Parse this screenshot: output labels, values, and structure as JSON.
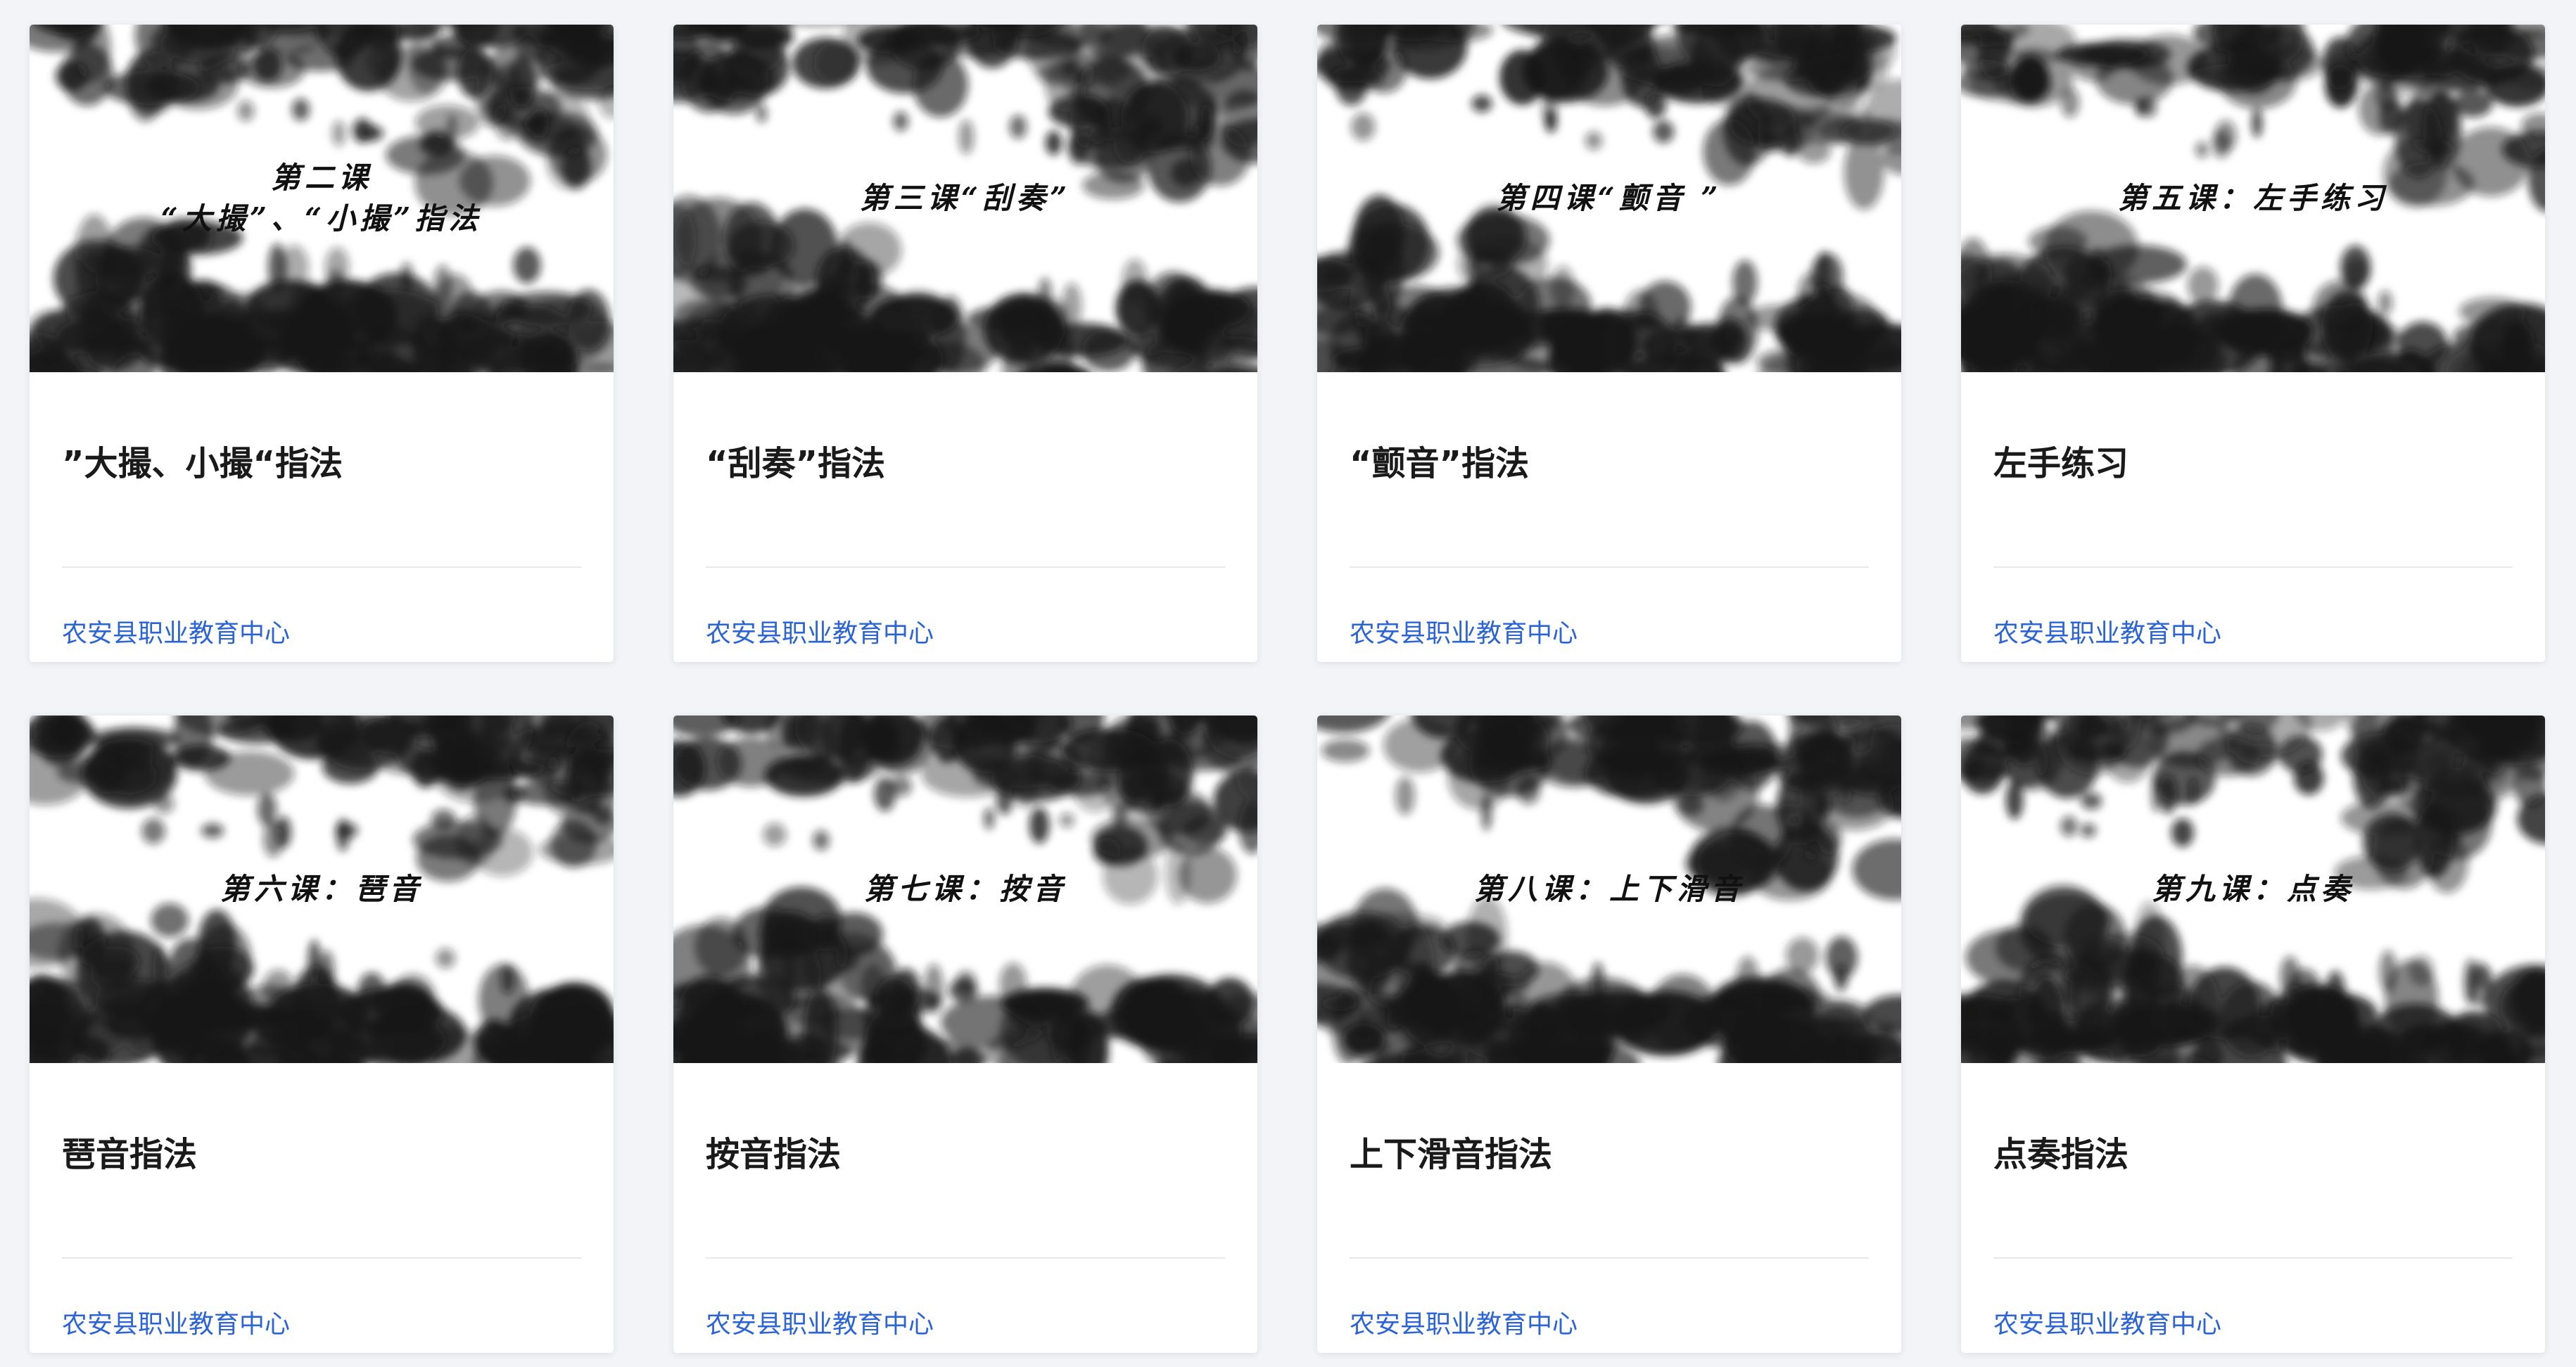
{
  "colors": {
    "page_background": "#f2f4f7",
    "card_background": "#ffffff",
    "title_text": "#1a1a1a",
    "org_link": "#2b64d6",
    "ink": "#111111"
  },
  "courses": [
    {
      "thumbnail_caption": "第二课\n“大撮”、“小撮”指法",
      "title": "”大撮、小撮“指法",
      "org": "农安县职业教育中心"
    },
    {
      "thumbnail_caption": "第三课“刮奏”",
      "title": "“刮奏”指法",
      "org": "农安县职业教育中心"
    },
    {
      "thumbnail_caption": "第四课“颤音 ”",
      "title": "“颤音”指法",
      "org": "农安县职业教育中心"
    },
    {
      "thumbnail_caption": "第五课：左手练习",
      "title": "左手练习",
      "org": "农安县职业教育中心"
    },
    {
      "thumbnail_caption": "第六课：琶音",
      "title": "琶音指法",
      "org": "农安县职业教育中心"
    },
    {
      "thumbnail_caption": "第七课：按音",
      "title": "按音指法",
      "org": "农安县职业教育中心"
    },
    {
      "thumbnail_caption": "第八课：上下滑音",
      "title": "上下滑音指法",
      "org": "农安县职业教育中心"
    },
    {
      "thumbnail_caption": "第九课：点奏",
      "title": "点奏指法",
      "org": "农安县职业教育中心"
    }
  ]
}
